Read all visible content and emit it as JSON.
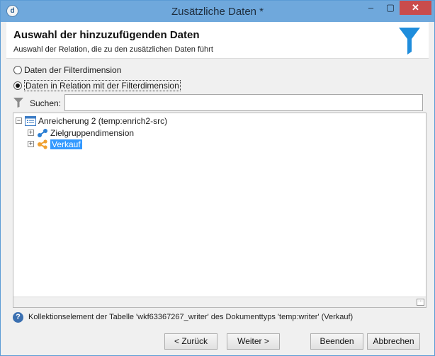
{
  "window": {
    "title": "Zusätzliche Daten *",
    "app_icon_glyph": "d",
    "controls": {
      "minimize": "–",
      "maximize": "▢",
      "close": "✕"
    }
  },
  "header": {
    "title": "Auswahl der hinzuzufügenden Daten",
    "subtitle": "Auswahl der Relation, die zu den zusätzlichen Daten führt",
    "icon": "funnel-icon",
    "icon_color": "#1f8ddc"
  },
  "options": {
    "option1": {
      "label": "Daten der Filterdimension",
      "checked": false
    },
    "option2": {
      "label": "Daten in Relation mit der Filterdimension",
      "checked": true
    }
  },
  "search": {
    "label": "Suchen:",
    "value": ""
  },
  "tree": {
    "root": {
      "label": "Anreicherung 2 (temp:enrich2-src)",
      "expander": "⊟",
      "icon": "list-icon"
    },
    "children": [
      {
        "label": "Zielgruppendimension",
        "expander": "+",
        "icon": "link-node-icon",
        "selected": false
      },
      {
        "label": "Verkauf",
        "expander": "+",
        "icon": "share-node-icon",
        "selected": true
      }
    ],
    "corner_glyph": "···"
  },
  "info": {
    "icon_glyph": "?",
    "text": "Kollektionselement der Tabelle 'wkf63367267_writer' des Dokumenttyps 'temp:writer' (Verkauf)"
  },
  "buttons": {
    "back": "< Zurück",
    "next": "Weiter >",
    "finish": "Beenden",
    "cancel": "Abbrechen"
  },
  "colors": {
    "titlebar": "#6fa8dc",
    "selection": "#3399ff",
    "close_button": "#c94c4c",
    "accent_orange": "#f0a030",
    "accent_blue": "#1f8ddc"
  }
}
